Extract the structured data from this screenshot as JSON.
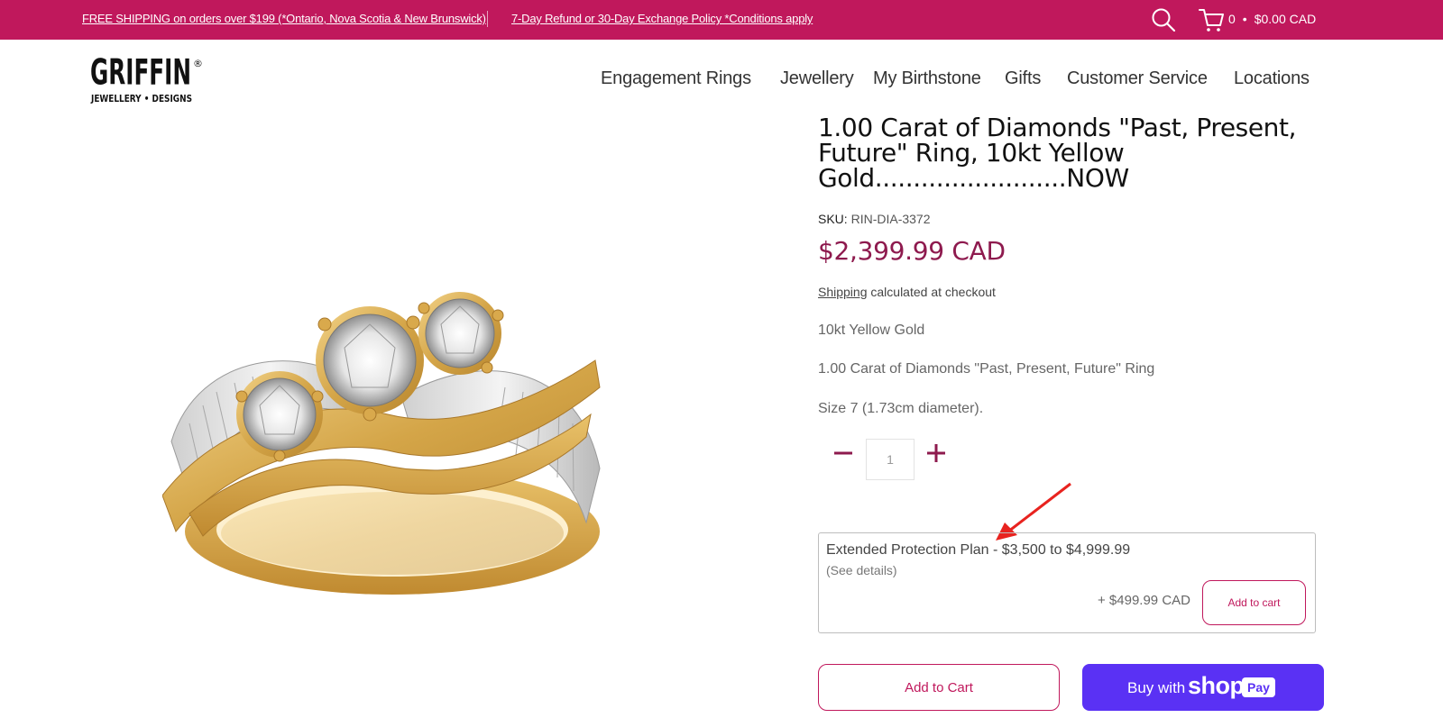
{
  "announcement": {
    "shipping_link": "FREE SHIPPING on orders over $199 (*Ontario, Nova Scotia & New Brunswick)",
    "refund_link": "7-Day Refund or 30-Day Exchange Policy *Conditions apply",
    "cart_count": "0",
    "cart_dot": "•",
    "cart_total": "$0.00 CAD",
    "icons": {
      "search": "search-icon",
      "cart": "cart-icon"
    }
  },
  "brand": {
    "name": "GRIFFIN",
    "tagline": "JEWELLERY • DESIGNS",
    "registered": "®"
  },
  "nav": {
    "items": [
      "Engagement Rings",
      "Jewellery",
      "My Birthstone",
      "Gifts",
      "Customer Service",
      "Locations"
    ]
  },
  "product": {
    "title": "1.00 Carat of Diamonds \"Past, Present, Future\" Ring, 10kt Yellow Gold.........................NOW",
    "sku_label": "SKU:",
    "sku": "RIN-DIA-3372",
    "price": "$2,399.99 CAD",
    "shipping_link": "Shipping",
    "shipping_text": " calculated at checkout",
    "desc": [
      "10kt Yellow Gold",
      "1.00 Carat of Diamonds \"Past, Present, Future\" Ring",
      "Size 7 (1.73cm diameter)."
    ],
    "quantity": "1"
  },
  "protection": {
    "title": "Extended Protection Plan - $3,500 to $4,999.99",
    "details": "(See details)",
    "price": "+ $499.99 CAD",
    "add_label": "Add to cart"
  },
  "actions": {
    "add_to_cart": "Add to Cart",
    "buy_with": "Buy with",
    "shop": "shop",
    "pay": "Pay"
  },
  "colors": {
    "brand": "#c0185c",
    "price": "#8e1a4e",
    "shoppay": "#5a31f4",
    "annotation_arrow": "#e8231f"
  }
}
